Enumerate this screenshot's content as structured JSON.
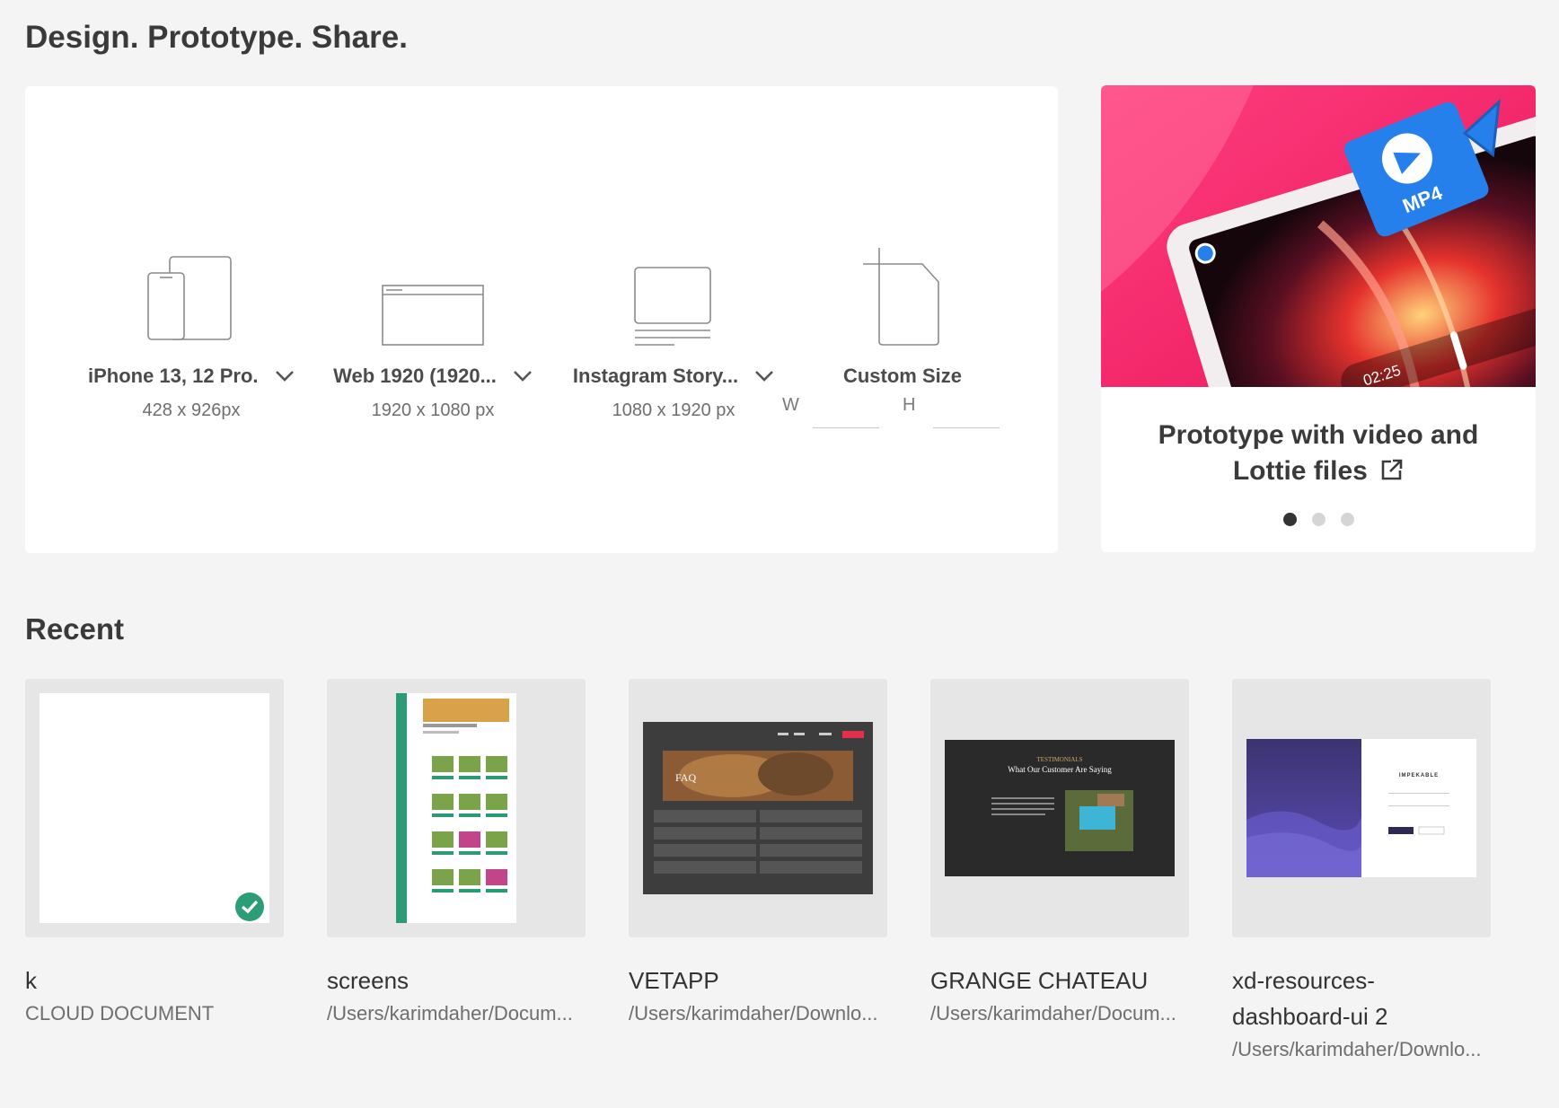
{
  "header": {
    "title": "Design. Prototype. Share."
  },
  "presets": [
    {
      "name": "iPhone 13, 12 Pro...",
      "size": "428 x 926px",
      "icon": "phone-tablet-icon"
    },
    {
      "name": "Web 1920 (1920...",
      "size": "1920 x 1080 px",
      "icon": "browser-window-icon"
    },
    {
      "name": "Instagram Story...",
      "size": "1080 x 1920 px",
      "icon": "instagram-story-icon"
    }
  ],
  "custom": {
    "name": "Custom Size",
    "w_label": "W",
    "h_label": "H",
    "w_value": "",
    "h_value": ""
  },
  "promo": {
    "title": "Prototype with video and Lottie files",
    "badge_text": "MP4",
    "time": "02:25",
    "accent": "#ff2d6f"
  },
  "recent": {
    "title": "Recent",
    "files": [
      {
        "name": "k",
        "path": "CLOUD DOCUMENT"
      },
      {
        "name": "screens",
        "path": "/Users/karimdaher/Docum..."
      },
      {
        "name": "VETAPP",
        "path": "/Users/karimdaher/Downlo..."
      },
      {
        "name": "GRANGE CHATEAU",
        "path": "/Users/karimdaher/Docum..."
      },
      {
        "name": "xd-resources-dashboard-ui 2",
        "path": "/Users/karimdaher/Downlo..."
      }
    ]
  },
  "thumbs": {
    "vetapp_banner": "FAQ",
    "grange_heading": "TESTIMONIALS",
    "grange_sub": "What Our Customer Are Saying",
    "xd_brand": "IMPEKABLE"
  }
}
